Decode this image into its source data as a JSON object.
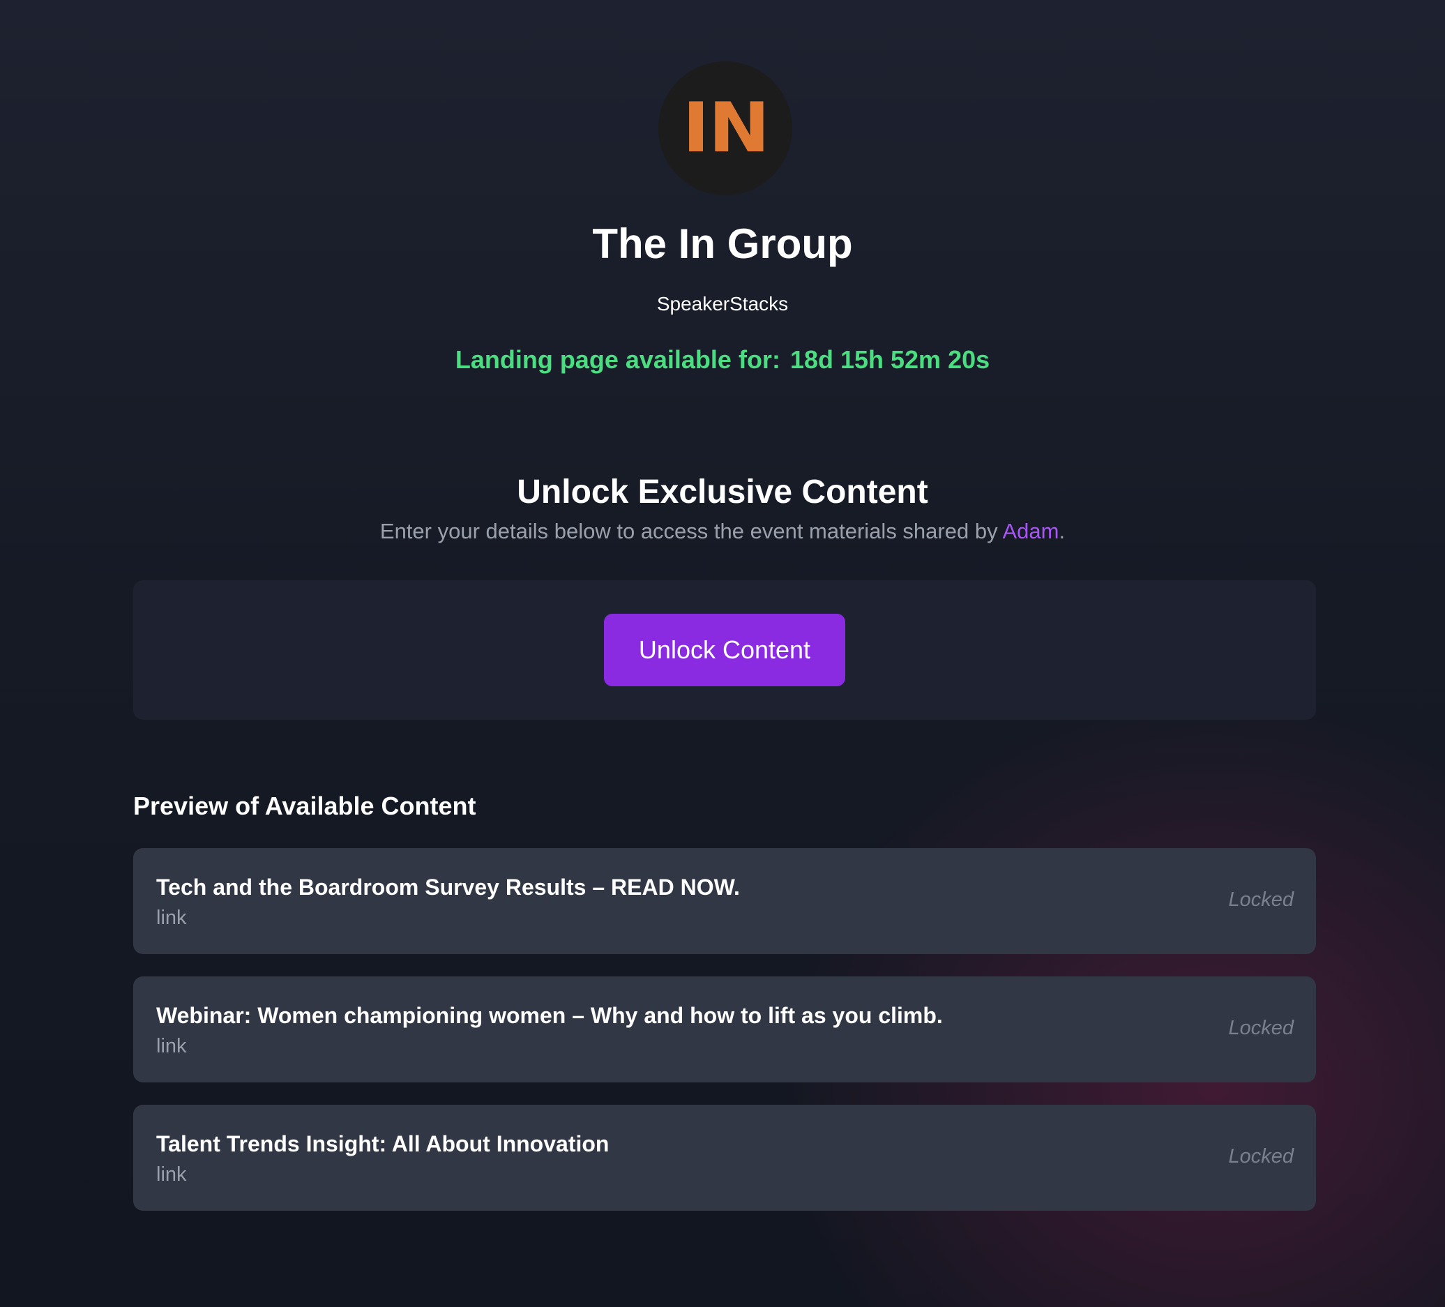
{
  "colors": {
    "logo_letters": "#e07a33",
    "countdown": "#4ade80",
    "accent_link": "#a855f7",
    "unlock_button": "#8a2be2"
  },
  "header": {
    "logo_text": "IN",
    "title": "The In Group",
    "subtitle": "SpeakerStacks",
    "countdown_label": "Landing page available for:",
    "countdown_value": "18d 15h 52m 20s"
  },
  "unlock": {
    "heading": "Unlock Exclusive Content",
    "description_before": "Enter your details below to access the event materials shared by ",
    "description_name": "Adam",
    "description_after": ".",
    "button_label": "Unlock Content"
  },
  "preview": {
    "heading": "Preview of Available Content",
    "items": [
      {
        "title": "Tech and the Boardroom Survey Results – READ NOW.",
        "type": "link",
        "status": "Locked"
      },
      {
        "title": "Webinar: Women championing women – Why and how to lift as you climb.",
        "type": "link",
        "status": "Locked"
      },
      {
        "title": "Talent Trends Insight: All About Innovation",
        "type": "link",
        "status": "Locked"
      }
    ]
  }
}
